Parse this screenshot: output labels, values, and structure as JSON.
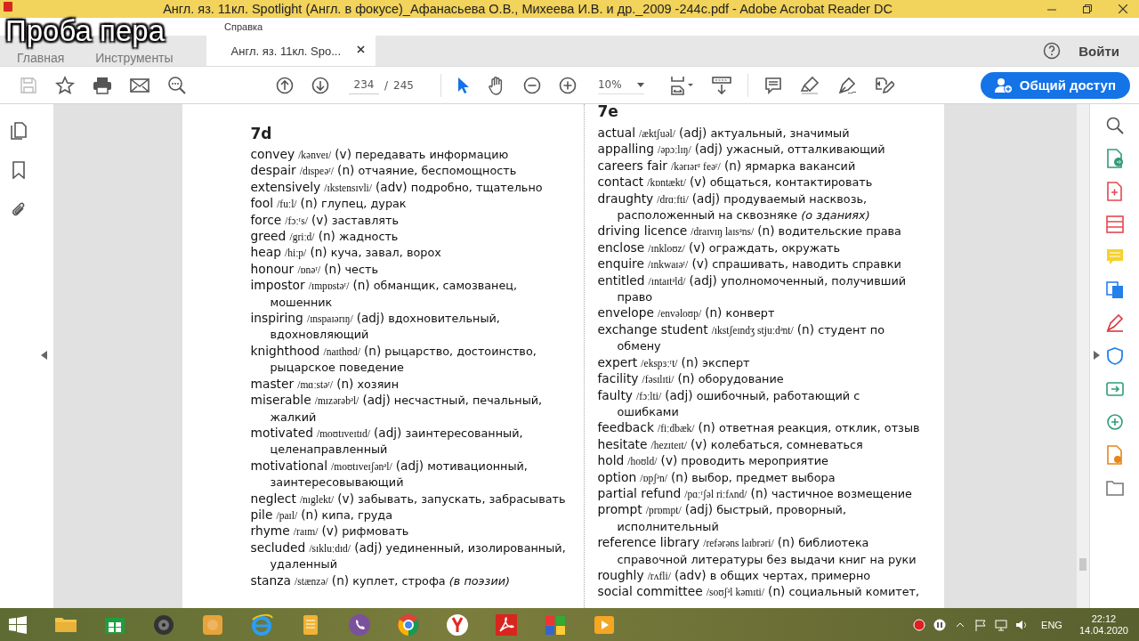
{
  "window": {
    "title": "Англ. яз. 11кл. Spotlight (Англ. в фокусе)_Афанасьева О.В., Михеева И.В. и др._2009 -244с.pdf - Adobe Acrobat Reader DC"
  },
  "overlay_caption": "Проба пера",
  "menu": [
    "Справка"
  ],
  "tabs": [
    {
      "label": "Главная",
      "selected": false,
      "closable": false
    },
    {
      "label": "Инструменты",
      "selected": false,
      "closable": false
    },
    {
      "label": "Англ. яз. 11кл. Spo...",
      "selected": true,
      "closable": true
    }
  ],
  "account": {
    "sign_in": "Войти"
  },
  "toolbar": {
    "page_current": "234",
    "page_separator": "/",
    "page_total": "245",
    "zoom": "10%",
    "share_button": "Общий доступ",
    "tools": [
      {
        "kind": "pointer",
        "selected": true
      },
      {
        "kind": "hand",
        "selected": false
      }
    ]
  },
  "document": {
    "columns": [
      {
        "heading": "7d",
        "entries": [
          {
            "word": "convey",
            "ipa": "/kənveɪ/",
            "pos": "(v)",
            "meaning": "передавать информацию"
          },
          {
            "word": "despair",
            "ipa": "/dɪspeəʳ/",
            "pos": "(n)",
            "meaning": "отчаяние, беспомощность"
          },
          {
            "word": "extensively",
            "ipa": "/ɪkstensɪvli/",
            "pos": "(adv)",
            "meaning": "подробно, тщательно"
          },
          {
            "word": "fool",
            "ipa": "/fuːl/",
            "pos": "(n)",
            "meaning": "глупец, дурак"
          },
          {
            "word": "force",
            "ipa": "/fɔːʳs/",
            "pos": "(v)",
            "meaning": "заставлять"
          },
          {
            "word": "greed",
            "ipa": "/griːd/",
            "pos": "(n)",
            "meaning": "жадность"
          },
          {
            "word": "heap",
            "ipa": "/hiːp/",
            "pos": "(n)",
            "meaning": "куча, завал, ворох"
          },
          {
            "word": "honour",
            "ipa": "/ɒnəʳ/",
            "pos": "(n)",
            "meaning": "честь"
          },
          {
            "word": "impostor",
            "ipa": "/ɪmpɒstəʳ/",
            "pos": "(n)",
            "meaning": "обманщик, самозванец, мошенник"
          },
          {
            "word": "inspiring",
            "ipa": "/ɪnspaɪərɪŋ/",
            "pos": "(adj)",
            "meaning": "вдохновительный, вдохновляющий"
          },
          {
            "word": "knighthood",
            "ipa": "/naɪthʊd/",
            "pos": "(n)",
            "meaning": "рыцарство, достоинство, рыцарское поведение"
          },
          {
            "word": "master",
            "ipa": "/mɑːstəʳ/",
            "pos": "(n)",
            "meaning": "хозяин"
          },
          {
            "word": "miserable",
            "ipa": "/mɪzərəbᵊl/",
            "pos": "(adj)",
            "meaning": "несчастный, печальный, жалкий"
          },
          {
            "word": "motivated",
            "ipa": "/moʊtɪveɪtɪd/",
            "pos": "(adj)",
            "meaning": "заинтересованный, целенаправленный"
          },
          {
            "word": "motivational",
            "ipa": "/moʊtɪveɪʃənᵊl/",
            "pos": "(adj)",
            "meaning": "мотивационный, заинтересовывающий"
          },
          {
            "word": "neglect",
            "ipa": "/nɪglekt/",
            "pos": "(v)",
            "meaning": "забывать, запускать, забрасывать"
          },
          {
            "word": "pile",
            "ipa": "/paɪl/",
            "pos": "(n)",
            "meaning": "кипа, груда"
          },
          {
            "word": "rhyme",
            "ipa": "/raɪm/",
            "pos": "(v)",
            "meaning": "рифмовать"
          },
          {
            "word": "secluded",
            "ipa": "/sɪkluːdɪd/",
            "pos": "(adj)",
            "meaning": "уединенный, изолированный, удаленный"
          },
          {
            "word": "stanza",
            "ipa": "/stænzə/",
            "pos": "(n)",
            "meaning": "куплет, строфа",
            "note": "(в поэзии)"
          }
        ]
      },
      {
        "heading": "7e",
        "entries": [
          {
            "word": "actual",
            "ipa": "/æktʃuəl/",
            "pos": "(adj)",
            "meaning": "актуальный, значимый"
          },
          {
            "word": "appalling",
            "ipa": "/əpɔːlɪŋ/",
            "pos": "(adj)",
            "meaning": "ужасный, отталкивающий"
          },
          {
            "word": "careers fair",
            "ipa": "/kərɪərᶻ feəʳ/",
            "pos": "(n)",
            "meaning": "ярмарка вакансий"
          },
          {
            "word": "contact",
            "ipa": "/kɒntækt/",
            "pos": "(v)",
            "meaning": "общаться, контактировать"
          },
          {
            "word": "draughty",
            "ipa": "/drɑːfti/",
            "pos": "(adj)",
            "meaning": "продуваемый насквозь, расположенный на сквозняке",
            "note": "(о зданиях)"
          },
          {
            "word": "driving licence",
            "ipa": "/draɪvɪŋ laɪsᵊns/",
            "pos": "(n)",
            "meaning": "водительские права"
          },
          {
            "word": "enclose",
            "ipa": "/ɪnkloʊz/",
            "pos": "(v)",
            "meaning": "ограждать, окружать"
          },
          {
            "word": "enquire",
            "ipa": "/ɪnkwaɪəʳ/",
            "pos": "(v)",
            "meaning": "спрашивать, наводить справки"
          },
          {
            "word": "entitled",
            "ipa": "/ɪntaɪtᵊld/",
            "pos": "(adj)",
            "meaning": "уполномоченный, получивший право"
          },
          {
            "word": "envelope",
            "ipa": "/envəloʊp/",
            "pos": "(n)",
            "meaning": "конверт"
          },
          {
            "word": "exchange student",
            "ipa": "/ɪkstʃeɪndʒ stjuːdᵊnt/",
            "pos": "(n)",
            "meaning": "студент по обмену"
          },
          {
            "word": "expert",
            "ipa": "/ekspɜːʳt/",
            "pos": "(n)",
            "meaning": "эксперт"
          },
          {
            "word": "facility",
            "ipa": "/fəsɪlɪti/",
            "pos": "(n)",
            "meaning": "оборудование"
          },
          {
            "word": "faulty",
            "ipa": "/fɔːlti/",
            "pos": "(adj)",
            "meaning": "ошибочный, работающий с ошибками"
          },
          {
            "word": "feedback",
            "ipa": "/fiːdbæk/",
            "pos": "(n)",
            "meaning": "ответная реакция, отклик, отзыв"
          },
          {
            "word": "hesitate",
            "ipa": "/hezɪteɪt/",
            "pos": "(v)",
            "meaning": "колебаться, сомневаться"
          },
          {
            "word": "hold",
            "ipa": "/hoʊld/",
            "pos": "(v)",
            "meaning": "проводить мероприятие"
          },
          {
            "word": "option",
            "ipa": "/ɒpʃᵊn/",
            "pos": "(n)",
            "meaning": "выбор, предмет выбора"
          },
          {
            "word": "partial refund",
            "ipa": "/pɑːʳʃəl riːfʌnd/",
            "pos": "(n)",
            "meaning": "частичное возмещение"
          },
          {
            "word": "prompt",
            "ipa": "/prɒmpt/",
            "pos": "(adj)",
            "meaning": "быстрый, проворный, исполнительный"
          },
          {
            "word": "reference library",
            "ipa": "/refərəns laɪbrəri/",
            "pos": "(n)",
            "meaning": "библиотека справочной литературы без выдачи книг на руки"
          },
          {
            "word": "roughly",
            "ipa": "/rʌfli/",
            "pos": "(adv)",
            "meaning": "в общих чертах, примерно"
          },
          {
            "word": "social committee",
            "ipa": "/soʊʃᵊl kəmɪti/",
            "pos": "(n)",
            "meaning": "социальный комитет,"
          }
        ]
      }
    ]
  },
  "taskbar": {
    "language": "ENG",
    "time": "22:12",
    "date": "14.04.2020"
  }
}
